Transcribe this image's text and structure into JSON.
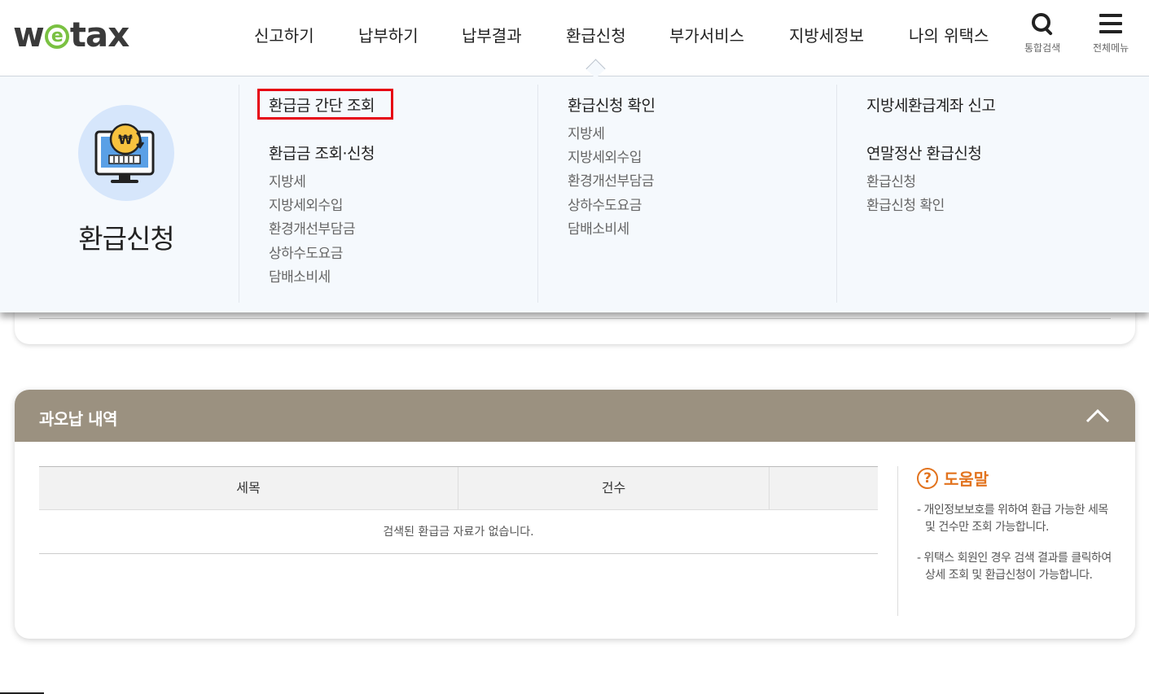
{
  "header": {
    "logo": {
      "pre": "w",
      "mid": "e",
      "post": "tax"
    },
    "nav": [
      "신고하기",
      "납부하기",
      "납부결과",
      "환급신청",
      "부가서비스",
      "지방세정보",
      "나의 위택스"
    ],
    "active_nav": "환급신청",
    "search_label": "통합검색",
    "menu_label": "전체메뉴"
  },
  "mega_menu": {
    "section_title": "환급신청",
    "col1": {
      "quick": "환급금 간단 조회",
      "group_title": "환급금 조회·신청",
      "items": [
        "지방세",
        "지방세외수입",
        "환경개선부담금",
        "상하수도요금",
        "담배소비세"
      ]
    },
    "col2": {
      "group_title": "환급신청 확인",
      "items": [
        "지방세",
        "지방세외수입",
        "환경개선부담금",
        "상하수도요금",
        "담배소비세"
      ]
    },
    "col3": {
      "group_title_1": "지방세환급계좌 신고",
      "group_title_2": "연말정산 환급신청",
      "items": [
        "환급신청",
        "환급신청 확인"
      ]
    }
  },
  "overpayment": {
    "title": "과오납 내역",
    "columns": [
      "세목",
      "건수",
      ""
    ],
    "empty_message": "검색된 환급금 자료가 없습니다.",
    "help": {
      "title": "도움말",
      "items": [
        "- 개인정보보호를 위하여 환급 가능한 세목 및 건수만 조회 가능합니다.",
        "- 위택스 회원인 경우 검색 결과를 클릭하여 상세 조회 및 환급신청이 가능합니다."
      ]
    }
  },
  "colors": {
    "accent_orange": "#e2731e",
    "card_header": "#9b9180",
    "highlight_red": "#e60012",
    "logo_green": "#7ac142",
    "mega_bg": "#f5f9fd"
  }
}
